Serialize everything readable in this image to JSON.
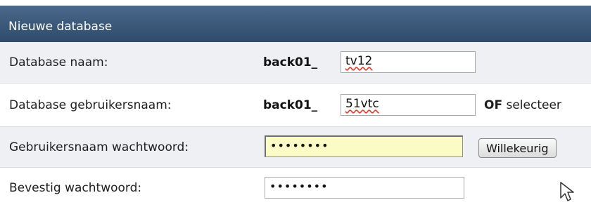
{
  "header": {
    "title": "Nieuwe database"
  },
  "form": {
    "db_name": {
      "label": "Database naam:",
      "prefix": "back01_",
      "value": "tv12"
    },
    "db_user": {
      "label": "Database gebruikersnaam:",
      "prefix": "back01_",
      "value": "51vtc",
      "or_bold": "OF",
      "or_rest": " selecteer"
    },
    "user_password": {
      "label": "Gebruikersnaam wachtwoord:",
      "value": "••••••••",
      "random_button": "Willekeurig"
    },
    "confirm_password": {
      "label": "Bevestig wachtwoord:",
      "value": "••••••••"
    }
  },
  "colors": {
    "header_bg": "#3a5878",
    "row_alt": "#eef0f3",
    "password_highlight": "#fbfbc6"
  },
  "icons": {
    "pointer": "mouse-pointer-icon"
  }
}
